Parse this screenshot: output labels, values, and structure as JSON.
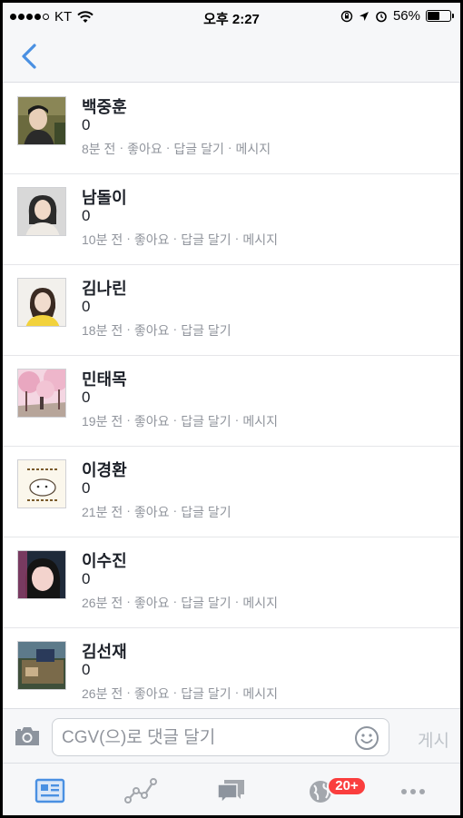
{
  "status_bar": {
    "carrier": "KT",
    "time": "오후 2:27",
    "battery": "56%"
  },
  "comments": [
    {
      "name": "백중훈",
      "text": "0",
      "time": "8분 전",
      "like": "좋아요",
      "reply": "답글 달기",
      "message": "메시지"
    },
    {
      "name": "남돌이",
      "text": "0",
      "time": "10분 전",
      "like": "좋아요",
      "reply": "답글 달기",
      "message": "메시지"
    },
    {
      "name": "김나린",
      "text": "0",
      "time": "18분 전",
      "like": "좋아요",
      "reply": "답글 달기",
      "message": ""
    },
    {
      "name": "민태목",
      "text": "0",
      "time": "19분 전",
      "like": "좋아요",
      "reply": "답글 달기",
      "message": "메시지"
    },
    {
      "name": "이경환",
      "text": "0",
      "time": "21분 전",
      "like": "좋아요",
      "reply": "답글 달기",
      "message": ""
    },
    {
      "name": "이수진",
      "text": "0",
      "time": "26분 전",
      "like": "좋아요",
      "reply": "답글 달기",
      "message": "메시지"
    },
    {
      "name": "김선재",
      "text": "0",
      "time": "26분 전",
      "like": "좋아요",
      "reply": "답글 달기",
      "message": "메시지"
    }
  ],
  "composer": {
    "placeholder": "CGV(으)로 댓글 달기",
    "post_label": "게시"
  },
  "tab_bar": {
    "notification_badge": "20+"
  },
  "colors": {
    "accent": "#4a90e2",
    "badge": "#fa3e3e",
    "meta_text": "#90949c"
  }
}
